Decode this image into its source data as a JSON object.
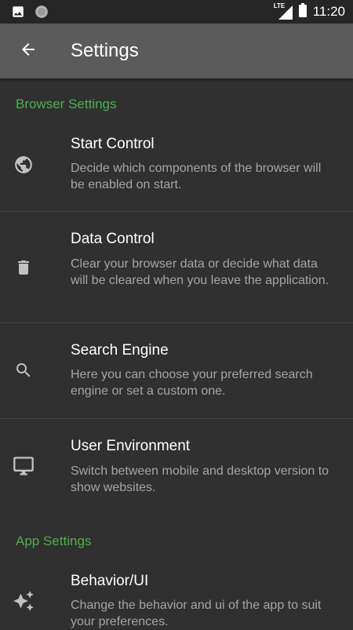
{
  "status_bar": {
    "time": "11:20",
    "network": "LTE",
    "icons": [
      "image-icon",
      "circle-notification-icon",
      "signal-icon",
      "battery-icon"
    ]
  },
  "toolbar": {
    "title": "Settings",
    "back_icon": "arrow-back-icon"
  },
  "sections": {
    "browser": {
      "header": "Browser Settings",
      "items": [
        {
          "title": "Start Control",
          "summary": "Decide which components of the browser will be enabled on start.",
          "icon": "globe-icon"
        },
        {
          "title": "Data Control",
          "summary": "Clear your browser data or decide what data will be cleared when you leave the application.",
          "icon": "trash-icon"
        },
        {
          "title": "Search Engine",
          "summary": "Here you can choose your preferred search engine or set a custom one.",
          "icon": "search-icon"
        },
        {
          "title": "User Environment",
          "summary": "Switch between mobile and desktop version to show websites.",
          "icon": "monitor-icon"
        }
      ]
    },
    "app": {
      "header": "App Settings",
      "items": [
        {
          "title": "Behavior/UI",
          "summary": "Change the behavior and ui of the app to suit your preferences.",
          "icon": "sparkles-icon"
        }
      ]
    }
  },
  "colors": {
    "accent": "#4caf50",
    "background": "#303030",
    "toolbar": "#5b5b5b",
    "status_bar": "#262626",
    "summary_text": "#a4a4a4"
  }
}
